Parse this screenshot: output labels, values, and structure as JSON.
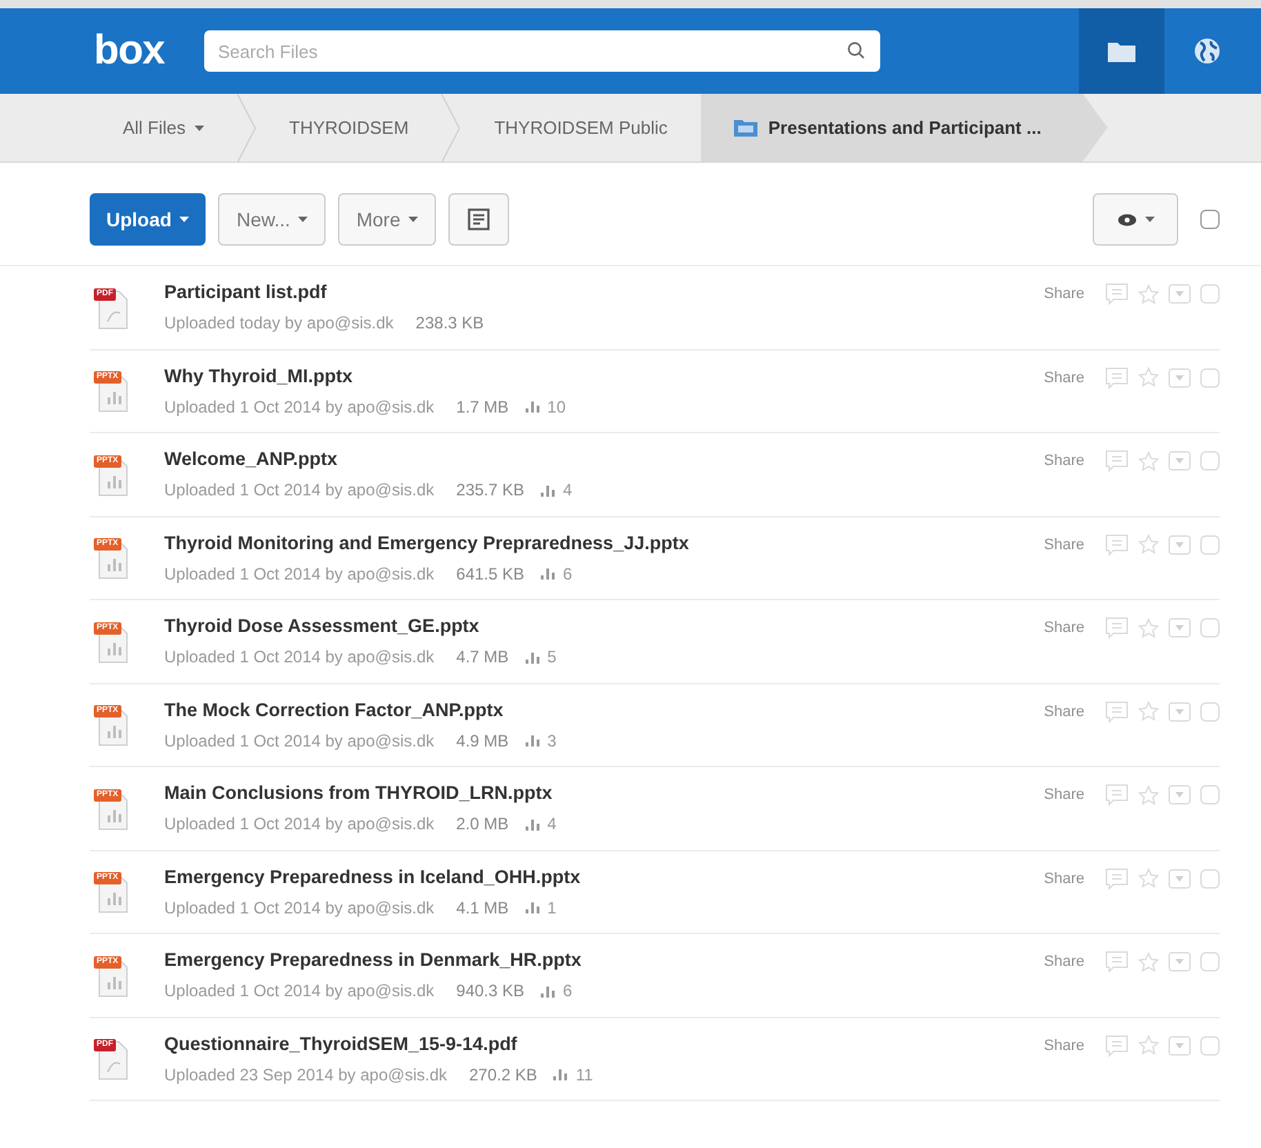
{
  "header": {
    "logo": "box",
    "search": {
      "placeholder": "Search Files"
    },
    "nav_icons": [
      {
        "kind": "folder",
        "selected": true
      },
      {
        "kind": "globe",
        "selected": false
      }
    ]
  },
  "breadcrumbs": [
    {
      "label": "All Files",
      "dropdown": true,
      "selected": false
    },
    {
      "label": "THYROIDSEM",
      "dropdown": false,
      "selected": false
    },
    {
      "label": "THYROIDSEM Public",
      "dropdown": false,
      "selected": false
    },
    {
      "label": "Presentations and Participant ...",
      "dropdown": false,
      "selected": true
    }
  ],
  "toolbar": {
    "buttons": [
      {
        "label": "Upload",
        "kind": "primary"
      },
      {
        "label": "New...",
        "kind": "dropdown"
      },
      {
        "label": "More",
        "kind": "dropdown"
      }
    ],
    "select_all": {
      "checked": false
    }
  },
  "files": [
    {
      "name": "Participant list.pdf",
      "kind": "pdf",
      "type": "PDF",
      "meta": "Uploaded today by apo@sis.dk",
      "size": "238.3 KB",
      "share": "Share",
      "checked": false
    },
    {
      "name": "Why Thyroid_MI.pptx",
      "kind": "pptx",
      "type": "PPTX",
      "meta": "Uploaded 1 Oct 2014 by apo@sis.dk",
      "size": "1.7 MB",
      "views": "10",
      "share": "Share",
      "checked": false
    },
    {
      "name": "Welcome_ANP.pptx",
      "kind": "pptx",
      "type": "PPTX",
      "meta": "Uploaded 1 Oct 2014 by apo@sis.dk",
      "size": "235.7 KB",
      "views": "4",
      "share": "Share",
      "checked": false
    },
    {
      "name": "Thyroid Monitoring and Emergency Prepraredness_JJ.pptx",
      "kind": "pptx",
      "type": "PPTX",
      "meta": "Uploaded 1 Oct 2014 by apo@sis.dk",
      "size": "641.5 KB",
      "views": "6",
      "share": "Share",
      "checked": false
    },
    {
      "name": "Thyroid Dose Assessment_GE.pptx",
      "kind": "pptx",
      "type": "PPTX",
      "meta": "Uploaded 1 Oct 2014 by apo@sis.dk",
      "size": "4.7 MB",
      "views": "5",
      "share": "Share",
      "checked": false
    },
    {
      "name": "The Mock Correction Factor_ANP.pptx",
      "kind": "pptx",
      "type": "PPTX",
      "meta": "Uploaded 1 Oct 2014 by apo@sis.dk",
      "size": "4.9 MB",
      "views": "3",
      "share": "Share",
      "checked": false
    },
    {
      "name": "Main Conclusions from THYROID_LRN.pptx",
      "kind": "pptx",
      "type": "PPTX",
      "meta": "Uploaded 1 Oct 2014 by apo@sis.dk",
      "size": "2.0 MB",
      "views": "4",
      "share": "Share",
      "checked": false
    },
    {
      "name": "Emergency Preparedness in Iceland_OHH.pptx",
      "kind": "pptx",
      "type": "PPTX",
      "meta": "Uploaded 1 Oct 2014 by apo@sis.dk",
      "size": "4.1 MB",
      "views": "1",
      "share": "Share",
      "checked": false
    },
    {
      "name": "Emergency Preparedness in Denmark_HR.pptx",
      "kind": "pptx",
      "type": "PPTX",
      "meta": "Uploaded 1 Oct 2014 by apo@sis.dk",
      "size": "940.3 KB",
      "views": "6",
      "share": "Share",
      "checked": false
    },
    {
      "name": "Questionnaire_ThyroidSEM_15-9-14.pdf",
      "kind": "pdf",
      "type": "PDF",
      "meta": "Uploaded 23 Sep 2014 by apo@sis.dk",
      "size": "270.2 KB",
      "views": "11",
      "share": "Share",
      "checked": false
    }
  ]
}
